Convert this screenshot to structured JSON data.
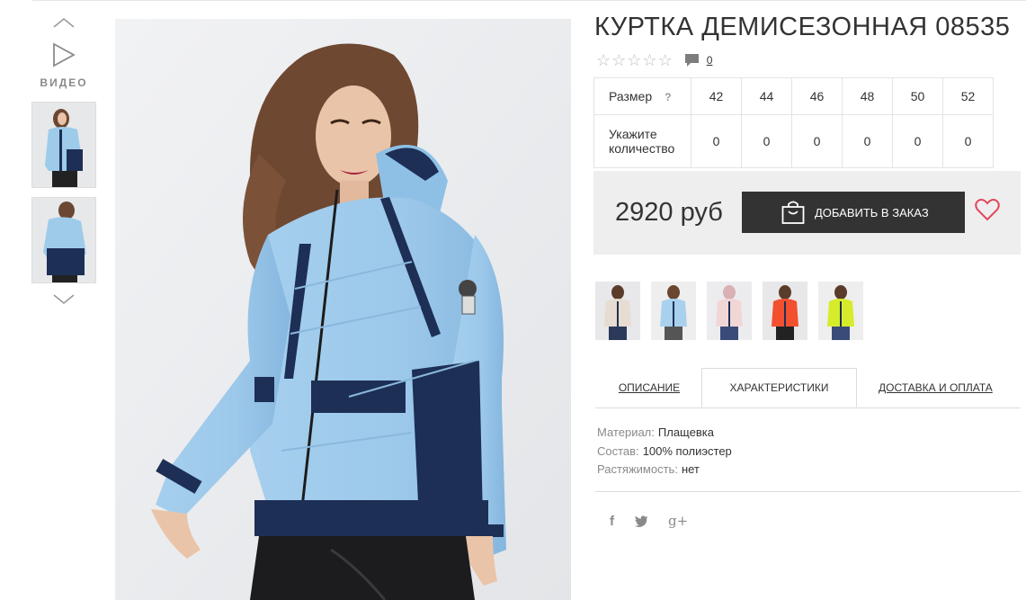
{
  "gallery": {
    "video_label": "ВИДЕО",
    "up_icon": "chevron-up-icon",
    "down_icon": "chevron-down-icon",
    "play_icon": "play-icon"
  },
  "product": {
    "title": "КУРТКА ДЕМИСЕЗОННАЯ 08535",
    "rating_stars": 0,
    "rating_max": 5,
    "comments_count": "0",
    "accent_color": "#e2475d"
  },
  "size_table": {
    "size_label": "Размер",
    "help": "?",
    "qty_label": "Укажите количество",
    "sizes": [
      "42",
      "44",
      "46",
      "48",
      "50",
      "52"
    ],
    "quantities": [
      "0",
      "0",
      "0",
      "0",
      "0",
      "0"
    ]
  },
  "purchase": {
    "price": "2920 руб",
    "add_label": "ДОБАВИТЬ В ЗАКАЗ"
  },
  "tabs": {
    "description": "ОПИСАНИЕ",
    "characteristics": "ХАРАКТЕРИСТИКИ",
    "delivery": "ДОСТАВКА И ОПЛАТА"
  },
  "properties": {
    "material_label": "Материал:",
    "material_value": "Плащевка",
    "composition_label": "Состав:",
    "composition_value": "100% полиэстер",
    "stretch_label": "Растяжимость:",
    "stretch_value": "нет"
  },
  "social": {
    "facebook": "f",
    "google": "g+"
  }
}
